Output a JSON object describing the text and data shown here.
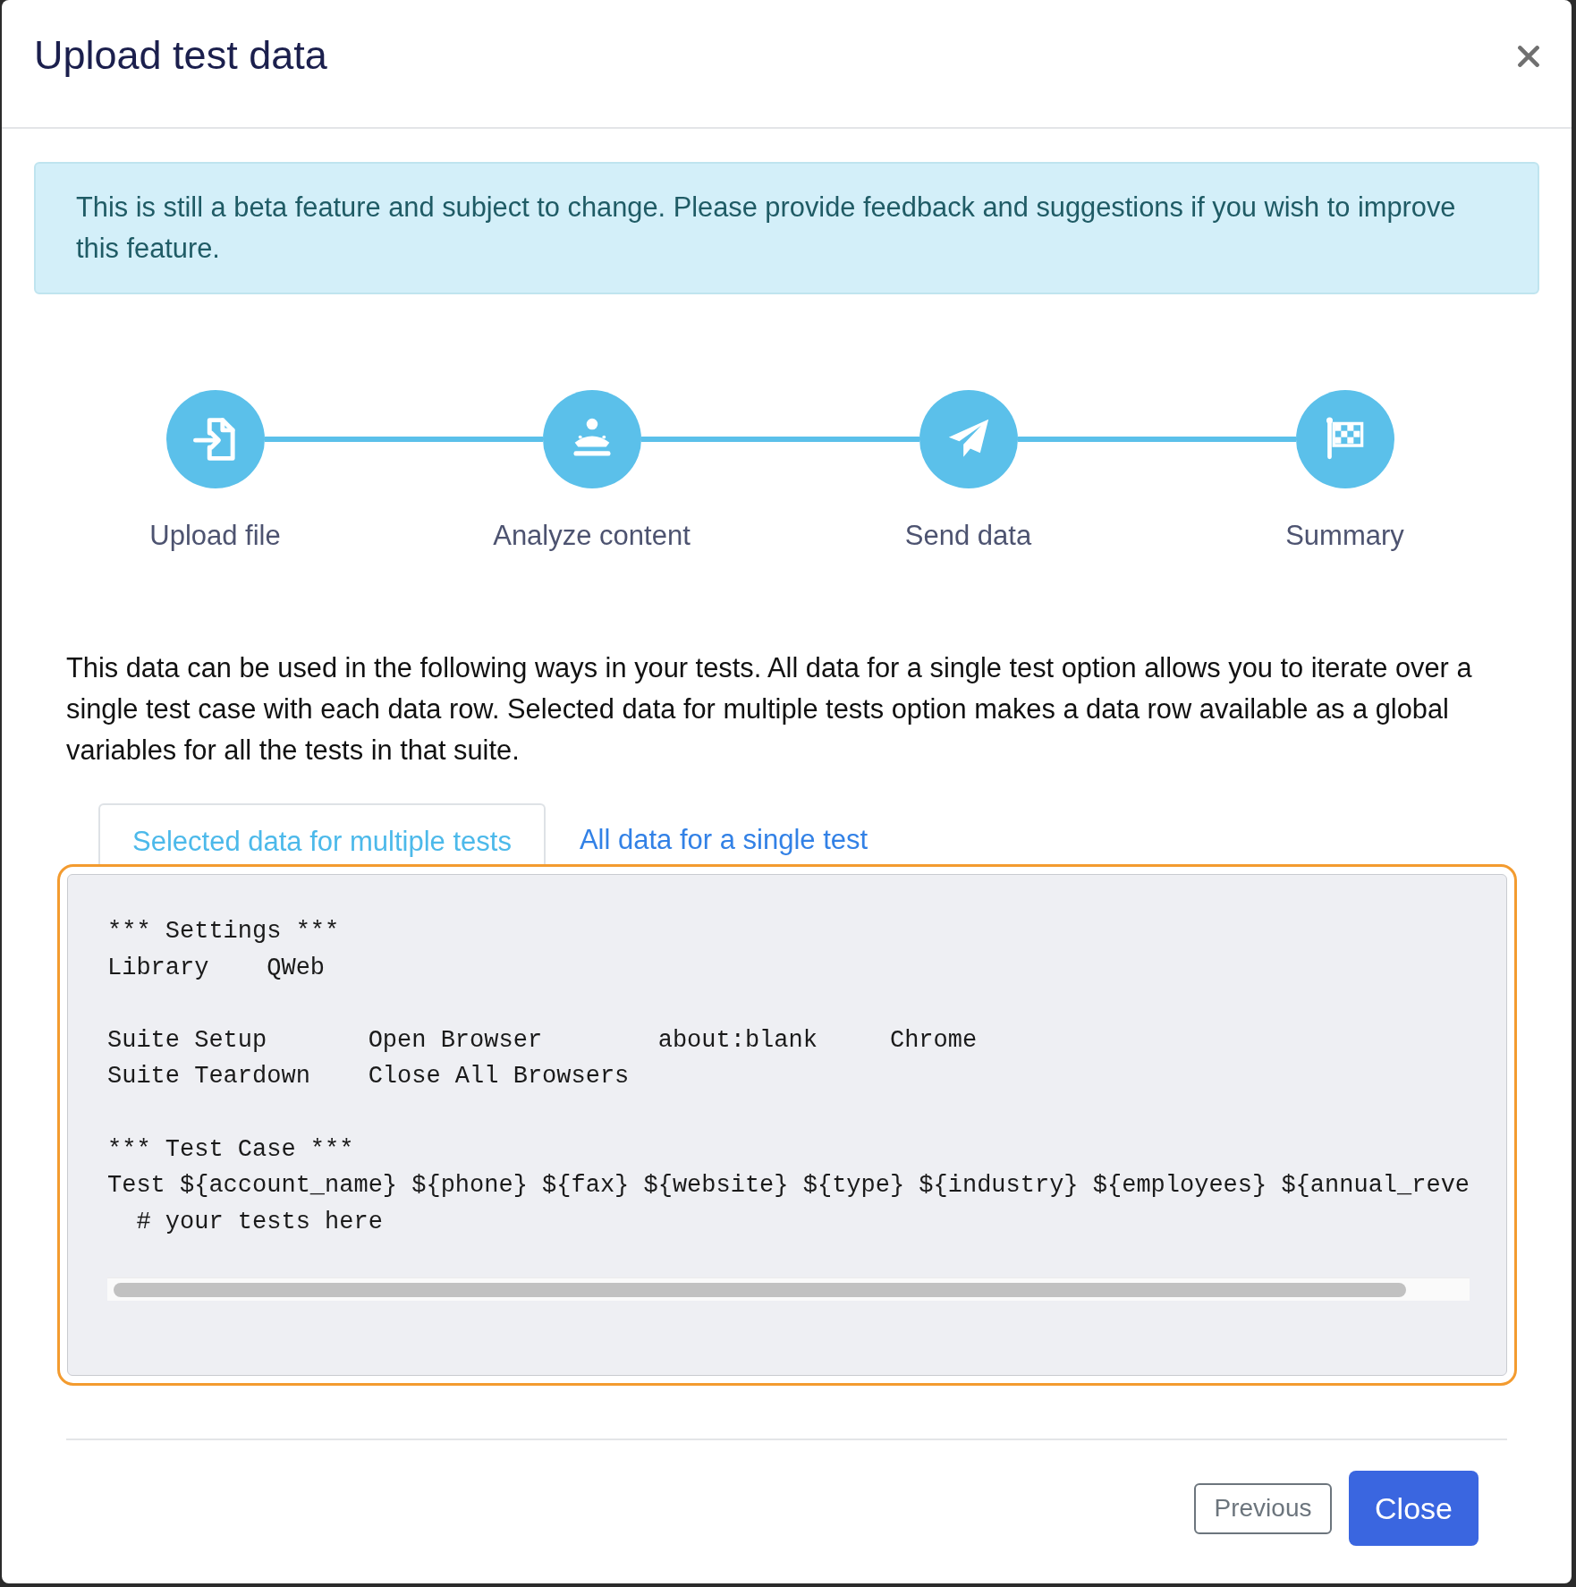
{
  "dialog": {
    "title": "Upload test data"
  },
  "alert": {
    "text": "This is still a beta feature and subject to change. Please provide feedback and suggestions if you wish to improve this feature."
  },
  "steps": [
    {
      "label": "Upload file",
      "kind": "upload"
    },
    {
      "label": "Analyze content",
      "kind": "analyze"
    },
    {
      "label": "Send data",
      "kind": "send"
    },
    {
      "label": "Summary",
      "kind": "summary"
    }
  ],
  "description": "This data can be used in the following ways in your tests. All data for a single test option allows you to iterate over a single test case with each data row. Selected data for multiple tests option makes a data row available as a global variables for all the tests in that suite.",
  "tabs": [
    {
      "label": "Selected data for multiple tests",
      "selected": true
    },
    {
      "label": "All data for a single test",
      "selected": false
    }
  ],
  "code_panel": {
    "focused": true,
    "code": "*** Settings ***\nLibrary    QWeb\n\nSuite Setup       Open Browser        about:blank     Chrome\nSuite Teardown    Close All Browsers\n\n*** Test Case ***\nTest ${account_name} ${phone} ${fax} ${website} ${type} ${industry} ${employees} ${annual_reve\n  # your tests here"
  },
  "buttons": [
    {
      "label": "Previous",
      "kind": "secondary"
    },
    {
      "label": "Close",
      "kind": "primary"
    }
  ]
}
